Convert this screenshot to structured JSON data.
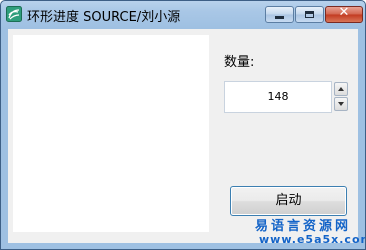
{
  "window": {
    "title": "环形进度 SOURCE/刘小源",
    "icon": "app-icon",
    "controls": {
      "minimize": "minimize",
      "maximize": "maximize",
      "close": "✕"
    }
  },
  "form": {
    "quantity_label": "数量:",
    "quantity_value": "148",
    "start_label": "启动"
  },
  "watermark": {
    "cn": "易语言资源网",
    "url": "www.e5a5x.com"
  },
  "colors": {
    "title_bar": "#a9c7e6",
    "close_button": "#c2391f",
    "watermark": "#1464c8",
    "button_border": "#3c7fb1"
  }
}
